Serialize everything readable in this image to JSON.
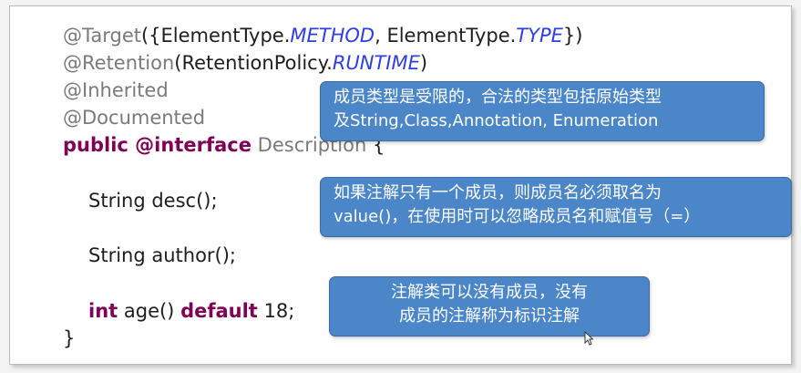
{
  "code": {
    "line1": {
      "prefix": "@Target",
      "paren_open": "({ElementType.",
      "method": "METHOD",
      "mid": ", ElementType.",
      "type": "TYPE",
      "close": "})"
    },
    "line2": {
      "prefix": "@Retention",
      "open": "(RetentionPolicy.",
      "runtime": "RUNTIME",
      "close": ")"
    },
    "line3": "@Inherited",
    "line4": "@Documented",
    "line5": {
      "kw": "public @interface",
      "name": "Description",
      "brace": "{"
    },
    "line6": "String desc();",
    "line7": "String author();",
    "line8": {
      "kw1": "int",
      "mid": "age()",
      "kw2": "default",
      "value": "18;"
    },
    "line9": "}"
  },
  "callouts": {
    "c1": {
      "line1": "成员类型是受限的，合法的类型包括原始类型",
      "line2": "及String,Class,Annotation, Enumeration"
    },
    "c2": {
      "line1": "如果注解只有一个成员，则成员名必须取名为",
      "line2": "value()，在使用时可以忽略成员名和赋值号（=）"
    },
    "c3": {
      "line1": "注解类可以没有成员，没有",
      "line2": "成员的注解称为标识注解"
    }
  },
  "colors": {
    "callout_bg": "#4a86c8",
    "keyword": "#7f0055",
    "italic_const": "#2d3ee6",
    "annotation_gray": "#7a7a7a"
  }
}
